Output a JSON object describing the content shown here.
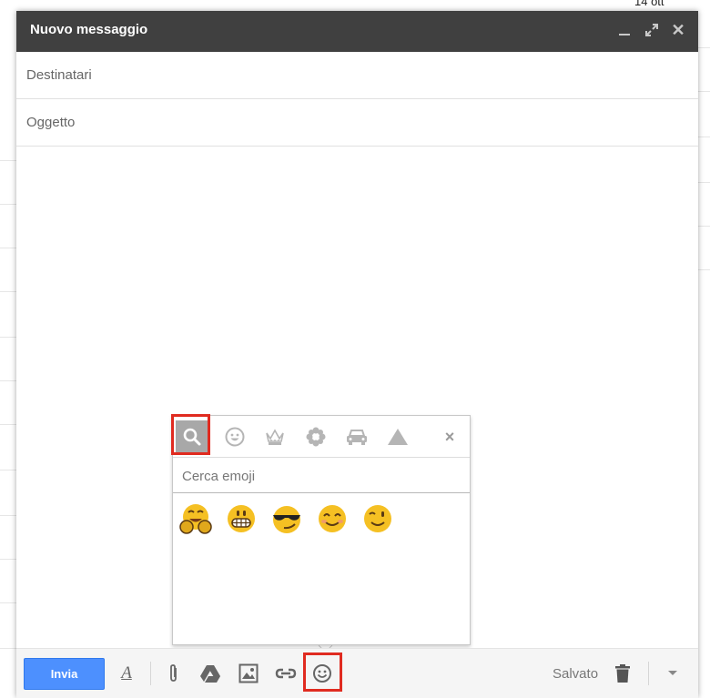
{
  "background": {
    "date_label": "14 ott"
  },
  "compose": {
    "title": "Nuovo messaggio",
    "to_placeholder": "Destinatari",
    "subject_placeholder": "Oggetto",
    "window_controls": [
      "minimize-icon",
      "expand-icon",
      "close-icon"
    ]
  },
  "emoji_picker": {
    "categories": [
      "search-icon",
      "smiley-icon",
      "crown-icon",
      "flower-icon",
      "car-icon",
      "triangle-icon"
    ],
    "close_label": "×",
    "search_placeholder": "Cerca emoji",
    "results": [
      "hugging-face",
      "grimacing-face",
      "cool-smirk-face",
      "smiling-face",
      "winking-face"
    ]
  },
  "toolbar": {
    "send_label": "Invia",
    "saved_label": "Salvato",
    "format_label": "A",
    "icons": [
      "format-text-icon",
      "attach-icon",
      "drive-icon",
      "photo-icon",
      "link-icon",
      "emoji-icon",
      "trash-icon",
      "more-options-icon"
    ]
  },
  "colors": {
    "titlebar": "#404040",
    "send_button": "#4d90fe",
    "highlight": "#e02b20",
    "emoji_yellow": "#f5c023"
  }
}
